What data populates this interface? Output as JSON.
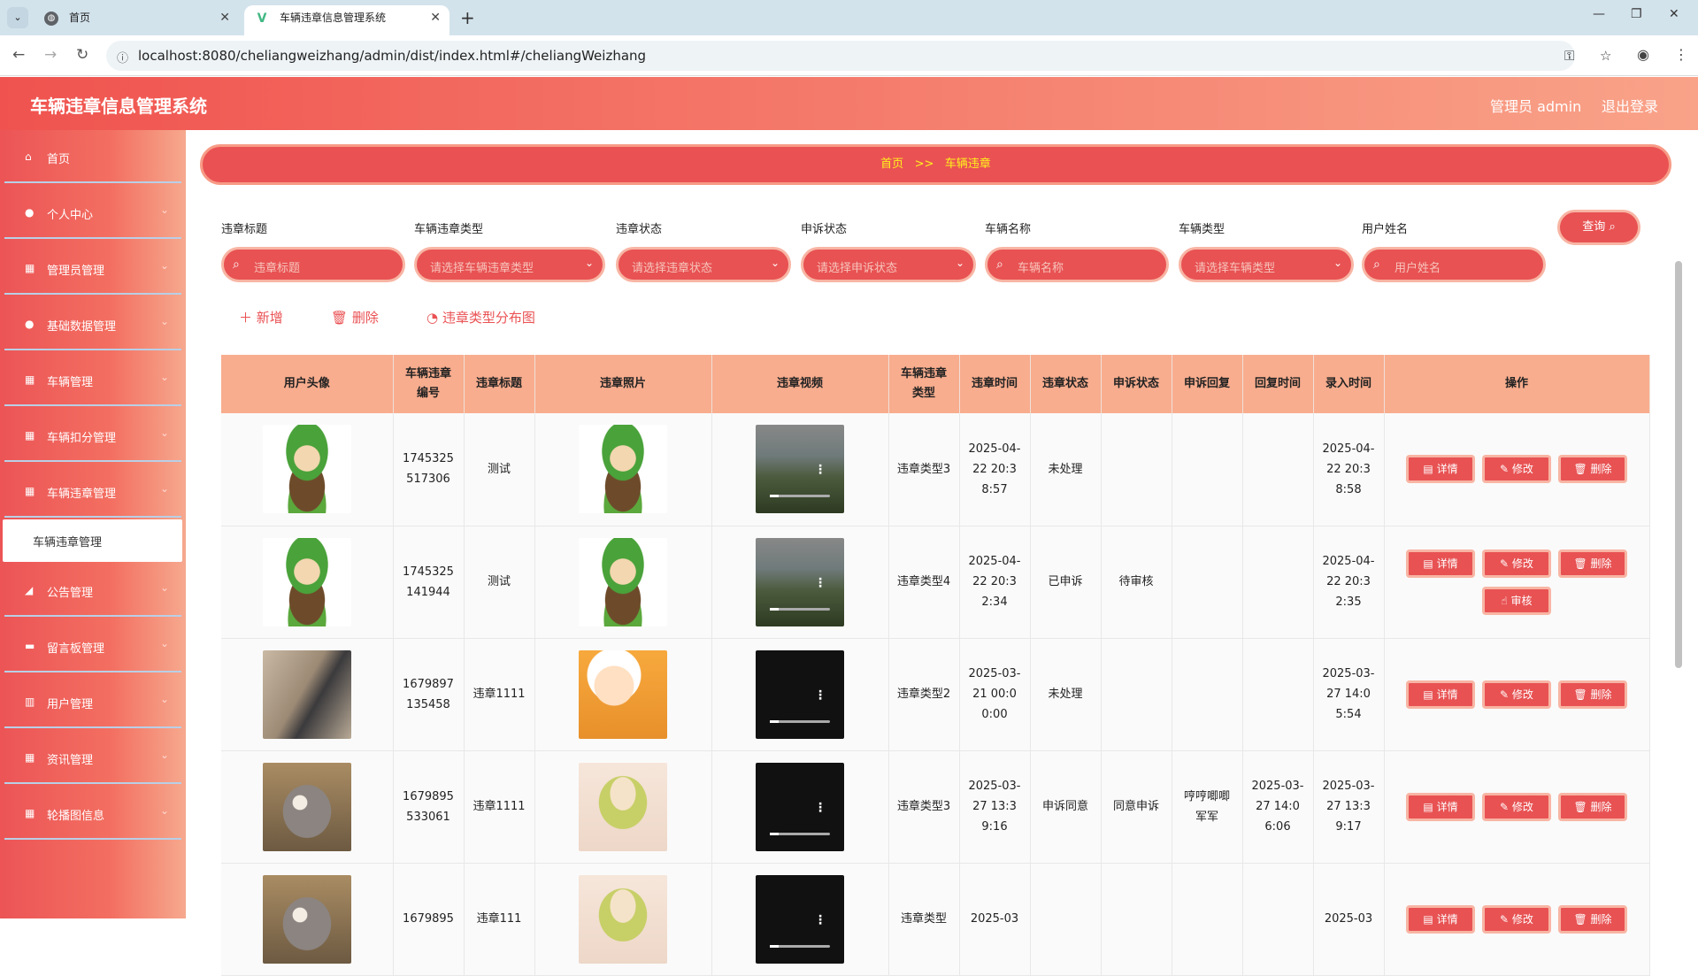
{
  "browser": {
    "tabs": [
      {
        "title": "首页",
        "icon": "globe-icon"
      },
      {
        "title": "车辆违章信息管理系统",
        "icon": "vue-icon"
      }
    ],
    "url": "localhost:8080/cheliangweizhang/admin/dist/index.html#/cheliangWeizhang"
  },
  "header": {
    "title": "车辆违章信息管理系统",
    "admin": "管理员 admin",
    "logout": "退出登录"
  },
  "sidebar": {
    "items": [
      {
        "label": "首页",
        "icon": "home-icon"
      },
      {
        "label": "个人中心",
        "icon": "user-icon"
      },
      {
        "label": "管理员管理",
        "icon": "grid-icon"
      },
      {
        "label": "基础数据管理",
        "icon": "location-icon"
      },
      {
        "label": "车辆管理",
        "icon": "grid-icon"
      },
      {
        "label": "车辆扣分管理",
        "icon": "grid-icon"
      },
      {
        "label": "车辆违章管理",
        "icon": "grid-icon"
      },
      {
        "label": "公告管理",
        "icon": "megaphone-icon"
      },
      {
        "label": "留言板管理",
        "icon": "chat-icon"
      },
      {
        "label": "用户管理",
        "icon": "bank-icon"
      },
      {
        "label": "资讯管理",
        "icon": "grid-icon"
      },
      {
        "label": "轮播图信息",
        "icon": "grid-icon"
      }
    ],
    "active_sub": "车辆违章管理"
  },
  "breadcrumb": {
    "home": "首页",
    "sep": ">>",
    "current": "车辆违章"
  },
  "filters": [
    {
      "label": "违章标题",
      "placeholder": "违章标题"
    },
    {
      "label": "车辆违章类型",
      "placeholder": "请选择车辆违章类型"
    },
    {
      "label": "违章状态",
      "placeholder": "请选择违章状态"
    },
    {
      "label": "申诉状态",
      "placeholder": "请选择申诉状态"
    },
    {
      "label": "车辆名称",
      "placeholder": "车辆名称"
    },
    {
      "label": "车辆类型",
      "placeholder": "请选择车辆类型"
    },
    {
      "label": "用户姓名",
      "placeholder": "用户姓名"
    }
  ],
  "query_button": "查询",
  "actions": {
    "add": "新增",
    "delete": "删除",
    "chart": "违章类型分布图"
  },
  "table": {
    "headers": [
      "用户头像",
      "车辆违章编号",
      "违章标题",
      "违章照片",
      "违章视频",
      "车辆违章类型",
      "违章时间",
      "违章状态",
      "申诉状态",
      "申诉回复",
      "回复时间",
      "录入时间",
      "操作"
    ],
    "row_buttons": {
      "detail": "详情",
      "edit": "修改",
      "delete": "删除",
      "audit": "审核"
    },
    "rows": [
      {
        "avatar": "av-link",
        "number": "1745325517306",
        "title": "测试",
        "photo": "av-link",
        "video": "scene",
        "type": "违章类型3",
        "time": "2025-04-22 20:38:57",
        "status": "未处理",
        "appeal": "",
        "reply": "",
        "reply_time": "",
        "entry_time": "2025-04-22 20:38:58",
        "audit": false
      },
      {
        "avatar": "av-link",
        "number": "1745325141944",
        "title": "测试",
        "photo": "av-link",
        "video": "scene",
        "type": "违章类型4",
        "time": "2025-04-22 20:32:34",
        "status": "已申诉",
        "appeal": "待审核",
        "reply": "",
        "reply_time": "",
        "entry_time": "2025-04-22 20:32:35",
        "audit": true
      },
      {
        "avatar": "av-photo",
        "number": "1679897135458",
        "title": "违章1111",
        "photo": "av-shin",
        "video": "dark",
        "type": "违章类型2",
        "time": "2025-03-21 00:00:00",
        "status": "未处理",
        "appeal": "",
        "reply": "",
        "reply_time": "",
        "entry_time": "2025-03-27 14:05:54",
        "audit": false
      },
      {
        "avatar": "av-cat",
        "number": "1679895533061",
        "title": "违章1111",
        "photo": "av-girl",
        "video": "dark",
        "type": "违章类型3",
        "time": "2025-03-27 13:39:16",
        "status": "申诉同意",
        "appeal": "同意申诉",
        "reply": "哼哼唧唧军军",
        "reply_time": "2025-03-27 14:06:06",
        "entry_time": "2025-03-27 13:39:17",
        "audit": false
      },
      {
        "avatar": "av-cat",
        "number": "1679895",
        "title": "违章111",
        "photo": "av-girl",
        "video": "dark",
        "type": "违章类型",
        "time": "2025-03",
        "status": "",
        "appeal": "",
        "reply": "",
        "reply_time": "",
        "entry_time": "2025-03",
        "audit": false
      }
    ]
  }
}
